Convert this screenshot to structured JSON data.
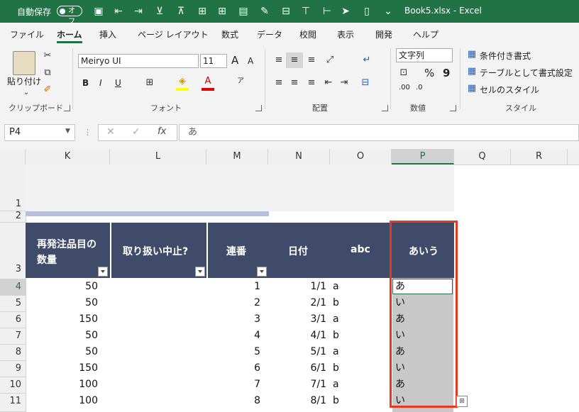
{
  "titlebar": {
    "autosave_label": "自動保存",
    "autosave_state": "オフ",
    "document_title": "Book5.xlsx  -  Excel"
  },
  "tabs": [
    "ファイル",
    "ホーム",
    "挿入",
    "ページ レイアウト",
    "数式",
    "データ",
    "校閲",
    "表示",
    "開発",
    "ヘルプ"
  ],
  "ribbon": {
    "clipboard": {
      "paste_label": "貼り付け",
      "group_label": "クリップボード"
    },
    "font": {
      "font_name": "Meiryo UI",
      "font_size": "11",
      "group_label": "フォント",
      "bold": "B",
      "italic": "I",
      "underline": "U",
      "grow": "A",
      "shrink": "A"
    },
    "alignment": {
      "group_label": "配置"
    },
    "number": {
      "format": "文字列",
      "percent": "%",
      "comma": "9",
      "group_label": "数値",
      "inc_decimal": ".00",
      "dec_decimal": ".0"
    },
    "styles": {
      "conditional": "条件付き書式",
      "table_format": "テーブルとして書式設定",
      "cell_styles": "セルのスタイル",
      "group_label": "スタイル"
    }
  },
  "formula_bar": {
    "name_box": "P4",
    "content": "あ"
  },
  "columns": [
    "K",
    "L",
    "M",
    "N",
    "O",
    "P",
    "Q",
    "R"
  ],
  "row_numbers": [
    "1",
    "2",
    "3",
    "4",
    "5",
    "6",
    "7",
    "8",
    "9",
    "10",
    "11"
  ],
  "table": {
    "headers": {
      "k": [
        "再発注品目の",
        "数量"
      ],
      "l": "取り扱い中止?",
      "m": "連番",
      "n": "日付",
      "o": "abc",
      "p": "あいう"
    },
    "rows": [
      {
        "k": "50",
        "m": "1",
        "n": "1/1",
        "o": "a",
        "p": "あ"
      },
      {
        "k": "50",
        "m": "2",
        "n": "2/1",
        "o": "b",
        "p": "い"
      },
      {
        "k": "150",
        "m": "3",
        "n": "3/1",
        "o": "a",
        "p": "あ"
      },
      {
        "k": "50",
        "m": "4",
        "n": "4/1",
        "o": "b",
        "p": "い"
      },
      {
        "k": "50",
        "m": "5",
        "n": "5/1",
        "o": "a",
        "p": "あ"
      },
      {
        "k": "150",
        "m": "6",
        "n": "6/1",
        "o": "b",
        "p": "い"
      },
      {
        "k": "100",
        "m": "7",
        "n": "7/1",
        "o": "a",
        "p": "あ"
      },
      {
        "k": "100",
        "m": "8",
        "n": "8/1",
        "o": "b",
        "p": "い"
      }
    ]
  },
  "colors": {
    "excel_green": "#217346",
    "table_header": "#3f4b68",
    "highlight_red": "#e8391c",
    "selection_gray": "#c8c8c8"
  }
}
